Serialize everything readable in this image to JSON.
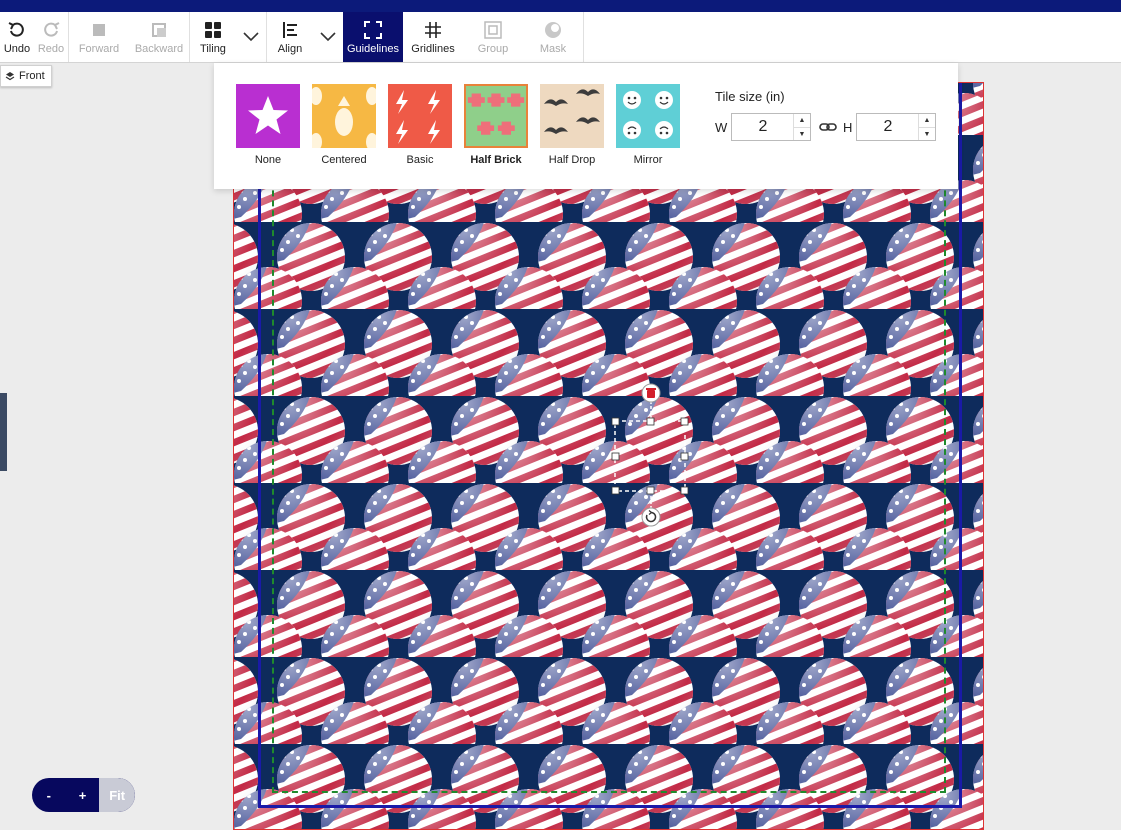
{
  "toolbar": {
    "undo": "Undo",
    "redo": "Redo",
    "forward": "Forward",
    "backward": "Backward",
    "tiling": "Tiling",
    "align": "Align",
    "guidelines": "Guidelines",
    "gridlines": "Gridlines",
    "group": "Group",
    "mask": "Mask"
  },
  "side_label": "Front",
  "tiling": {
    "options": [
      {
        "label": "None",
        "color": "#b92fd1"
      },
      {
        "label": "Centered",
        "color": "#f6b844"
      },
      {
        "label": "Basic",
        "color": "#ef5a47"
      },
      {
        "label": "Half Brick",
        "color": "#8fcf8a",
        "selected": true
      },
      {
        "label": "Half Drop",
        "color": "#eed9c0"
      },
      {
        "label": "Mirror",
        "color": "#5fcfd6"
      }
    ],
    "tile_size_label": "Tile size (in)",
    "w_label": "W",
    "h_label": "H",
    "w_value": "2",
    "h_value": "2"
  },
  "zoom": {
    "minus": "-",
    "plus": "+",
    "fit": "Fit"
  },
  "colors": {
    "topbar": "#0c1a7a",
    "active_tab": "#0a0f6e",
    "canvas_bg": "#0e2b5c",
    "selected_border": "#e8823a"
  }
}
